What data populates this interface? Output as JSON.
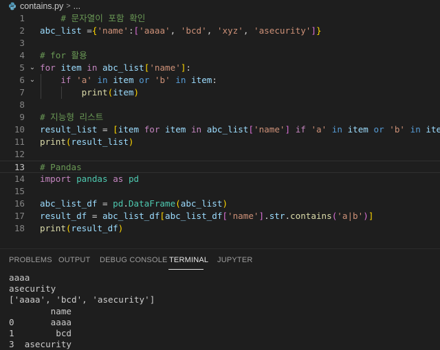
{
  "breadcrumb": {
    "file": "contains.py",
    "separator": ">",
    "more": "..."
  },
  "editor": {
    "lines": [
      {
        "n": "1",
        "tokens": [
          {
            "t": "    ",
            "c": "op"
          },
          {
            "t": "# 문자열이 포함 확인",
            "c": "comment"
          }
        ]
      },
      {
        "n": "2",
        "tokens": [
          {
            "t": "abc_list",
            "c": "var"
          },
          {
            "t": " =",
            "c": "op"
          },
          {
            "t": "{",
            "c": "br1"
          },
          {
            "t": "'name'",
            "c": "str"
          },
          {
            "t": ":",
            "c": "op"
          },
          {
            "t": "[",
            "c": "br2"
          },
          {
            "t": "'aaaa'",
            "c": "str"
          },
          {
            "t": ", ",
            "c": "op"
          },
          {
            "t": "'bcd'",
            "c": "str"
          },
          {
            "t": ", ",
            "c": "op"
          },
          {
            "t": "'xyz'",
            "c": "str"
          },
          {
            "t": ", ",
            "c": "op"
          },
          {
            "t": "'asecurity'",
            "c": "str"
          },
          {
            "t": "]",
            "c": "br2"
          },
          {
            "t": "}",
            "c": "br1"
          }
        ]
      },
      {
        "n": "3",
        "tokens": []
      },
      {
        "n": "4",
        "tokens": [
          {
            "t": "# for 활용",
            "c": "comment"
          }
        ]
      },
      {
        "n": "5",
        "fold": "⌄",
        "tokens": [
          {
            "t": "for",
            "c": "kw"
          },
          {
            "t": " ",
            "c": "op"
          },
          {
            "t": "item",
            "c": "var"
          },
          {
            "t": " ",
            "c": "op"
          },
          {
            "t": "in",
            "c": "kw"
          },
          {
            "t": " ",
            "c": "op"
          },
          {
            "t": "abc_list",
            "c": "var"
          },
          {
            "t": "[",
            "c": "br1"
          },
          {
            "t": "'name'",
            "c": "str"
          },
          {
            "t": "]",
            "c": "br1"
          },
          {
            "t": ":",
            "c": "op"
          }
        ]
      },
      {
        "n": "6",
        "fold": "⌄",
        "tokens": [
          {
            "t": "    ",
            "c": "op"
          },
          {
            "t": "if",
            "c": "kw"
          },
          {
            "t": " ",
            "c": "op"
          },
          {
            "t": "'a'",
            "c": "str"
          },
          {
            "t": " ",
            "c": "op"
          },
          {
            "t": "in",
            "c": "kw2"
          },
          {
            "t": " ",
            "c": "op"
          },
          {
            "t": "item",
            "c": "var"
          },
          {
            "t": " ",
            "c": "op"
          },
          {
            "t": "or",
            "c": "kw2"
          },
          {
            "t": " ",
            "c": "op"
          },
          {
            "t": "'b'",
            "c": "str"
          },
          {
            "t": " ",
            "c": "op"
          },
          {
            "t": "in",
            "c": "kw2"
          },
          {
            "t": " ",
            "c": "op"
          },
          {
            "t": "item",
            "c": "var"
          },
          {
            "t": ":",
            "c": "op"
          }
        ]
      },
      {
        "n": "7",
        "tokens": [
          {
            "t": "        ",
            "c": "op"
          },
          {
            "t": "print",
            "c": "fn"
          },
          {
            "t": "(",
            "c": "br1"
          },
          {
            "t": "item",
            "c": "var"
          },
          {
            "t": ")",
            "c": "br1"
          }
        ]
      },
      {
        "n": "8",
        "tokens": []
      },
      {
        "n": "9",
        "tokens": [
          {
            "t": "# 지능형 리스트",
            "c": "comment"
          }
        ]
      },
      {
        "n": "10",
        "tokens": [
          {
            "t": "result_list",
            "c": "var"
          },
          {
            "t": " = ",
            "c": "op"
          },
          {
            "t": "[",
            "c": "br1"
          },
          {
            "t": "item",
            "c": "var"
          },
          {
            "t": " ",
            "c": "op"
          },
          {
            "t": "for",
            "c": "kw"
          },
          {
            "t": " ",
            "c": "op"
          },
          {
            "t": "item",
            "c": "var"
          },
          {
            "t": " ",
            "c": "op"
          },
          {
            "t": "in",
            "c": "kw"
          },
          {
            "t": " ",
            "c": "op"
          },
          {
            "t": "abc_list",
            "c": "var"
          },
          {
            "t": "[",
            "c": "br2"
          },
          {
            "t": "'name'",
            "c": "str"
          },
          {
            "t": "]",
            "c": "br2"
          },
          {
            "t": " ",
            "c": "op"
          },
          {
            "t": "if",
            "c": "kw"
          },
          {
            "t": " ",
            "c": "op"
          },
          {
            "t": "'a'",
            "c": "str"
          },
          {
            "t": " ",
            "c": "op"
          },
          {
            "t": "in",
            "c": "kw2"
          },
          {
            "t": " ",
            "c": "op"
          },
          {
            "t": "item",
            "c": "var"
          },
          {
            "t": " ",
            "c": "op"
          },
          {
            "t": "or",
            "c": "kw2"
          },
          {
            "t": " ",
            "c": "op"
          },
          {
            "t": "'b'",
            "c": "str"
          },
          {
            "t": " ",
            "c": "op"
          },
          {
            "t": "in",
            "c": "kw2"
          },
          {
            "t": " ",
            "c": "op"
          },
          {
            "t": "item",
            "c": "var"
          },
          {
            "t": "]",
            "c": "br1"
          }
        ]
      },
      {
        "n": "11",
        "tokens": [
          {
            "t": "print",
            "c": "fn"
          },
          {
            "t": "(",
            "c": "br1"
          },
          {
            "t": "result_list",
            "c": "var"
          },
          {
            "t": ")",
            "c": "br1"
          }
        ]
      },
      {
        "n": "12",
        "tokens": []
      },
      {
        "n": "13",
        "current": true,
        "tokens": [
          {
            "t": "# Pandas",
            "c": "comment"
          }
        ]
      },
      {
        "n": "14",
        "tokens": [
          {
            "t": "import",
            "c": "kw"
          },
          {
            "t": " ",
            "c": "op"
          },
          {
            "t": "pandas",
            "c": "cls"
          },
          {
            "t": " ",
            "c": "op"
          },
          {
            "t": "as",
            "c": "kw"
          },
          {
            "t": " ",
            "c": "op"
          },
          {
            "t": "pd",
            "c": "cls"
          }
        ]
      },
      {
        "n": "15",
        "tokens": []
      },
      {
        "n": "16",
        "tokens": [
          {
            "t": "abc_list_df",
            "c": "var"
          },
          {
            "t": " = ",
            "c": "op"
          },
          {
            "t": "pd",
            "c": "cls"
          },
          {
            "t": ".",
            "c": "op"
          },
          {
            "t": "DataFrame",
            "c": "cls"
          },
          {
            "t": "(",
            "c": "br1"
          },
          {
            "t": "abc_list",
            "c": "var"
          },
          {
            "t": ")",
            "c": "br1"
          }
        ]
      },
      {
        "n": "17",
        "tokens": [
          {
            "t": "result_df",
            "c": "var"
          },
          {
            "t": " = ",
            "c": "op"
          },
          {
            "t": "abc_list_df",
            "c": "var"
          },
          {
            "t": "[",
            "c": "br1"
          },
          {
            "t": "abc_list_df",
            "c": "var"
          },
          {
            "t": "[",
            "c": "br2"
          },
          {
            "t": "'name'",
            "c": "str"
          },
          {
            "t": "]",
            "c": "br2"
          },
          {
            "t": ".",
            "c": "op"
          },
          {
            "t": "str",
            "c": "var"
          },
          {
            "t": ".",
            "c": "op"
          },
          {
            "t": "contains",
            "c": "fn"
          },
          {
            "t": "(",
            "c": "br2"
          },
          {
            "t": "'a|b'",
            "c": "str"
          },
          {
            "t": ")",
            "c": "br2"
          },
          {
            "t": "]",
            "c": "br1"
          }
        ]
      },
      {
        "n": "18",
        "tokens": [
          {
            "t": "print",
            "c": "fn"
          },
          {
            "t": "(",
            "c": "br1"
          },
          {
            "t": "result_df",
            "c": "var"
          },
          {
            "t": ")",
            "c": "br1"
          }
        ]
      }
    ]
  },
  "panel": {
    "tabs": [
      "PROBLEMS",
      "OUTPUT",
      "DEBUG CONSOLE",
      "TERMINAL",
      "JUPYTER"
    ],
    "active_tab": "TERMINAL"
  },
  "terminal": {
    "lines": [
      "aaaa",
      "asecurity",
      "['aaaa', 'bcd', 'asecurity']",
      "        name",
      "0       aaaa",
      "1        bcd",
      "3  asecurity"
    ]
  }
}
